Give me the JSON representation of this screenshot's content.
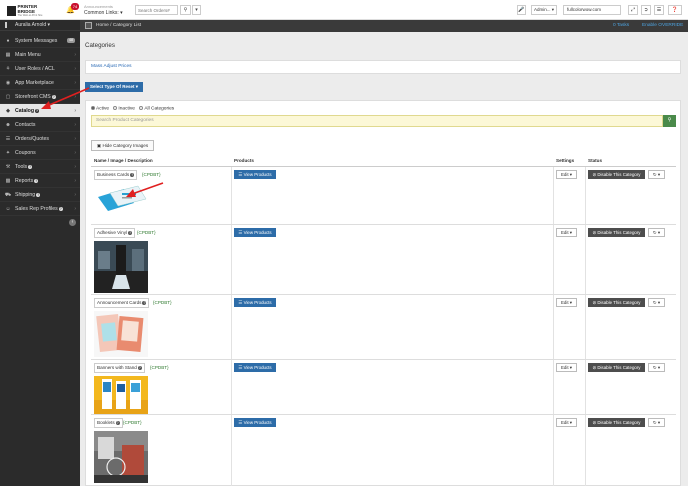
{
  "topbar": {
    "logo_text": "PRINTER BRIDGE",
    "logo_sub": "The Web-to-Print Site",
    "notification_count": "74",
    "announcements_label": "Announcements",
    "common_links": "Common Links:",
    "search_placeholder": "Search Orders#",
    "admin_label": "Admin...",
    "domain_value": "fullcolorwow.com"
  },
  "sidebar": {
    "user": "Auralia Arnold",
    "items": [
      {
        "label": "System Messages",
        "icon": "bell-icon",
        "badge": "48"
      },
      {
        "label": "Main Menu",
        "icon": "grid-icon"
      },
      {
        "label": "User Roles / ACL",
        "icon": "key-icon"
      },
      {
        "label": "App Marketplace",
        "icon": "cart-icon"
      },
      {
        "label": "Storefront CMS",
        "icon": "monitor-icon"
      },
      {
        "label": "Catalog",
        "icon": "tag-icon"
      },
      {
        "label": "Contacts",
        "icon": "users-icon"
      },
      {
        "label": "Orders/Quotes",
        "icon": "list-icon"
      },
      {
        "label": "Coupons",
        "icon": "coupon-icon"
      },
      {
        "label": "Tools",
        "icon": "wrench-icon"
      },
      {
        "label": "Reports",
        "icon": "chart-icon"
      },
      {
        "label": "Shipping",
        "icon": "truck-icon"
      },
      {
        "label": "Sales Rep Profiles",
        "icon": "user-icon"
      }
    ]
  },
  "breadcrumb": {
    "home": "Home",
    "separator": "/",
    "current": "Category List",
    "tasks": "0 Tasks",
    "override": "Enable OVERRIDE"
  },
  "page": {
    "title": "Categories",
    "mass_adjust": "Mass Adjust Prices",
    "reset_button": "Select Type Of Reset",
    "radio_active": "Active",
    "radio_inactive": "Inactive",
    "radio_all": "All Categories",
    "search_placeholder": "Search Product Categories",
    "hide_images": "Hide Category Images"
  },
  "table": {
    "headers": [
      "Name / Image / Description",
      "Products",
      "Settings",
      "Status"
    ],
    "view_products": "View Products",
    "edit": "Edit",
    "disable": "Disable This Category",
    "rows": [
      {
        "name": "Business Cards",
        "code": "{CPDBT}"
      },
      {
        "name": "Adhesive Vinyl",
        "code": "{CPDBT}"
      },
      {
        "name": "Announcement Cards",
        "code": "{CPDBT}"
      },
      {
        "name": "Banners with Stand",
        "code": "{CPDBT}"
      },
      {
        "name": "Booklets",
        "code": "{CPDBT}"
      }
    ]
  },
  "colors": {
    "accent_blue": "#2d6ca8",
    "annotation_red": "#e02020",
    "sidebar_bg": "#2b2b2b",
    "code_green": "#2f7a2f"
  }
}
